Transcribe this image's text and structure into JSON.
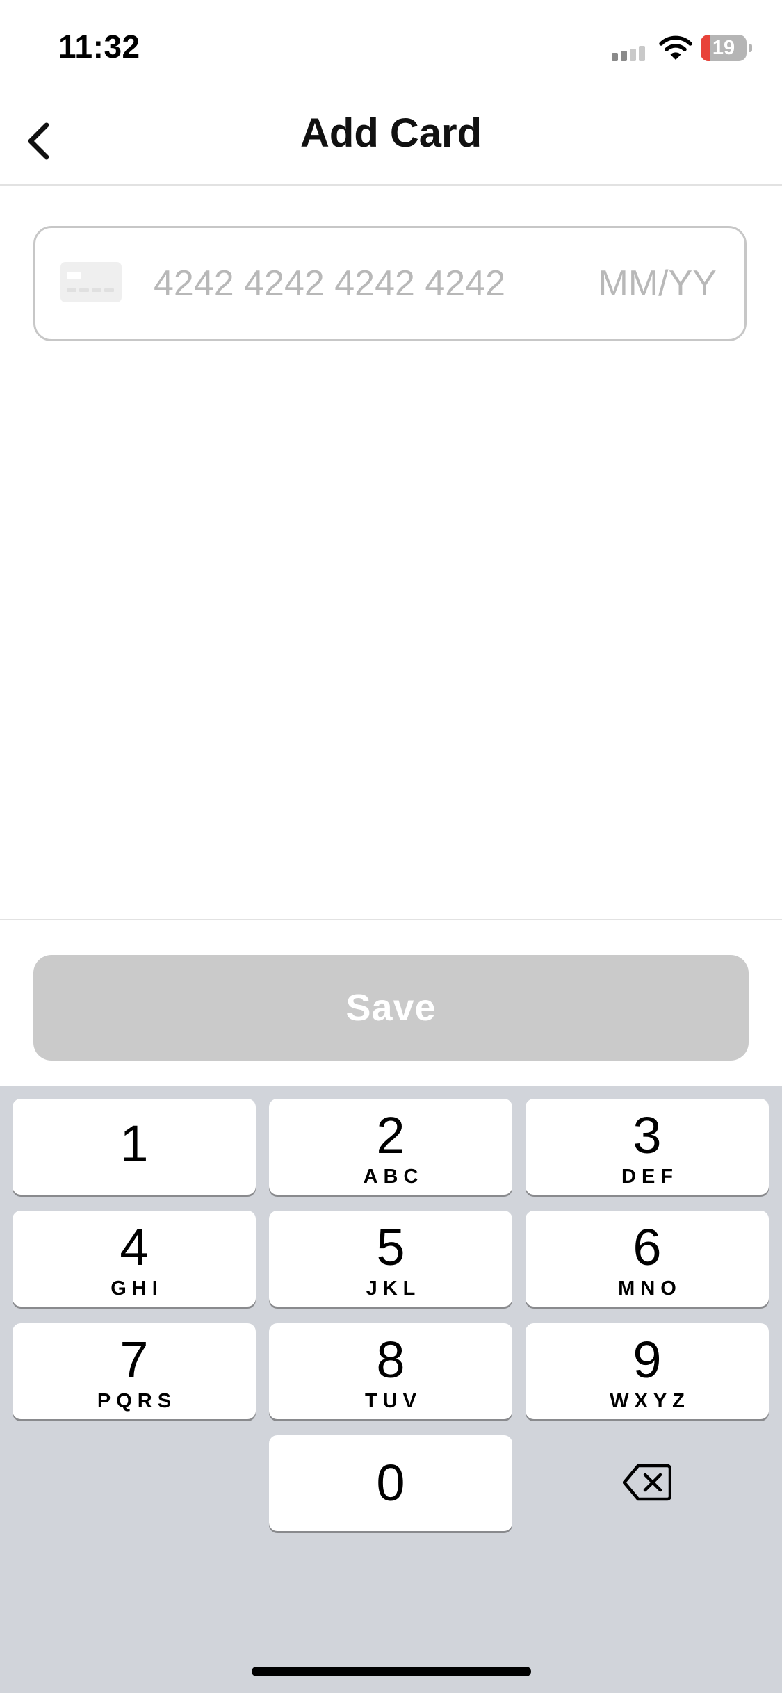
{
  "status_bar": {
    "time": "11:32",
    "battery_level": "19",
    "battery_percent": 19,
    "signal_bars_active": 2,
    "signal_bars_total": 4
  },
  "nav": {
    "title": "Add Card",
    "back_icon": "chevron-left-icon"
  },
  "card_form": {
    "card_icon": "credit-card-icon",
    "card_number": {
      "value": "",
      "placeholder": "4242 4242 4242 4242"
    },
    "expiry": {
      "value": "",
      "placeholder": "MM/YY"
    }
  },
  "save_button": {
    "label": "Save",
    "enabled": false
  },
  "keypad": {
    "keys": [
      {
        "digit": "1",
        "letters": ""
      },
      {
        "digit": "2",
        "letters": "ABC"
      },
      {
        "digit": "3",
        "letters": "DEF"
      },
      {
        "digit": "4",
        "letters": "GHI"
      },
      {
        "digit": "5",
        "letters": "JKL"
      },
      {
        "digit": "6",
        "letters": "MNO"
      },
      {
        "digit": "7",
        "letters": "PQRS"
      },
      {
        "digit": "8",
        "letters": "TUV"
      },
      {
        "digit": "9",
        "letters": "WXYZ"
      },
      {
        "digit": "0",
        "letters": ""
      }
    ],
    "delete_icon": "backspace-icon"
  },
  "colors": {
    "battery_low": "#e8433a",
    "save_disabled": "#cacaca",
    "keypad_background": "#d1d4da",
    "placeholder": "#b8b8b8",
    "field_border": "#c7c7c7"
  }
}
